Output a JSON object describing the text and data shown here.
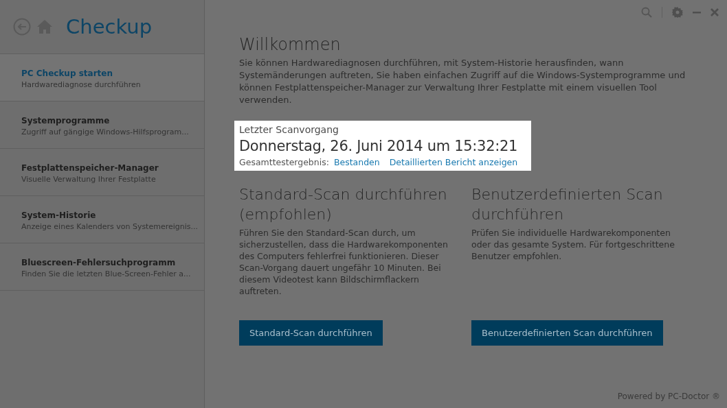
{
  "sidebar": {
    "title": "Checkup",
    "items": [
      {
        "title": "PC Checkup starten",
        "subtitle": "Hardwarediagnose durchführen",
        "selected": true
      },
      {
        "title": "Systemprogramme",
        "subtitle": "Zugriff auf gängige Windows-Hilfsprogram...",
        "selected": false
      },
      {
        "title": "Festplattenspeicher-Manager",
        "subtitle": "Visuelle Verwaltung Ihrer Festplatte",
        "selected": false
      },
      {
        "title": "System-Historie",
        "subtitle": "Anzeige eines Kalenders von Systemereignis...",
        "selected": false
      },
      {
        "title": "Bluescreen-Fehlersuchprogramm",
        "subtitle": "Finden Sie die letzten Blue-Screen-Fehler a...",
        "selected": false
      }
    ]
  },
  "welcome": {
    "heading": "Willkommen",
    "text": "Sie können Hardwarediagnosen durchführen, mit System-Historie herausfinden, wann Systemänderungen auftreten, Sie haben einfachen Zugriff auf die Windows-Systemprogramme und können Festplattenspeicher-Manager zur Verwaltung Ihrer Festplatte mit einem visuellen Tool verwenden."
  },
  "last_scan": {
    "label": "Letzter Scanvorgang",
    "date": "Donnerstag, 26. Juni 2014 um 15:32:21",
    "result_label": "Gesamttestergebnis:",
    "result": "Bestanden",
    "report_link": "Detaillierten Bericht anzeigen"
  },
  "scan_options": [
    {
      "heading": "Standard-Scan durchführen (empfohlen)",
      "text": "Führen Sie den Standard-Scan durch, um sicherzustellen, dass die Hardwarekomponenten des Computers fehlerfrei funktionieren. Dieser Scan-Vorgang dauert ungefähr 10 Minuten. Bei diesem Videotest kann Bildschirmflackern auftreten.",
      "button": "Standard-Scan durchführen"
    },
    {
      "heading": "Benutzerdefinierten Scan durchführen",
      "text": "Prüfen Sie individuelle Hardwarekomponenten oder das gesamte System. Für fortgeschrittene Benutzer empfohlen.",
      "button": "Benutzerdefinierten Scan durchführen"
    }
  ],
  "footer": "Powered by PC-Doctor ®"
}
